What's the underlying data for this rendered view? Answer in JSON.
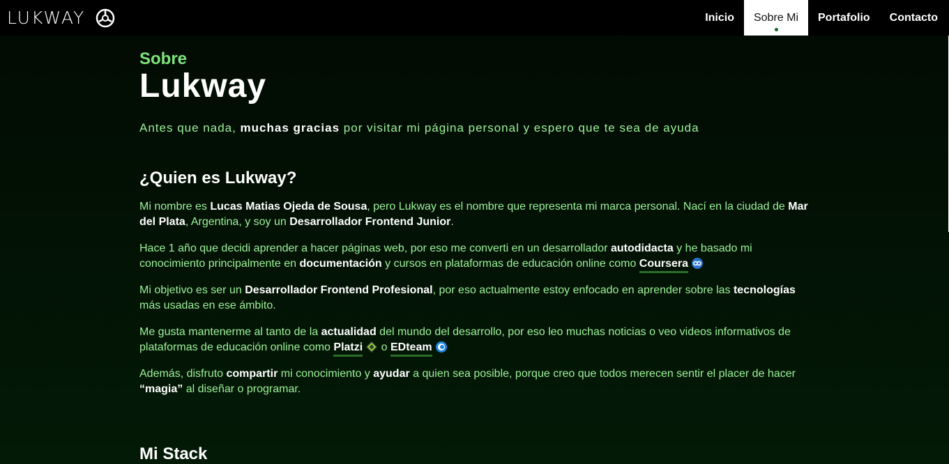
{
  "brand": {
    "name": "LUKWAY"
  },
  "nav": {
    "items": [
      {
        "label": "Inicio",
        "active": false
      },
      {
        "label": "Sobre Mi",
        "active": true
      },
      {
        "label": "Portafolio",
        "active": false
      },
      {
        "label": "Contacto",
        "active": false
      }
    ]
  },
  "hero": {
    "eyebrow": "Sobre",
    "title": "Lukway",
    "intro_pre": "Antes que nada, ",
    "intro_bold": "muchas gracias",
    "intro_post": " por visitar mi página personal y espero que te sea de ayuda"
  },
  "about": {
    "heading": "¿Quien es Lukway?",
    "p1": {
      "a": "Mi nombre es ",
      "b": "Lucas Matias Ojeda de Sousa",
      "c": ", pero Lukway es el nombre que representa mi marca personal. Nací en la ciudad de ",
      "d": "Mar del Plata",
      "e": ", Argentina, y soy un ",
      "f": "Desarrollador Frontend Junior",
      "g": "."
    },
    "p2": {
      "a": "Hace 1 año que decidi aprender a hacer páginas web, por eso me converti en un desarrollador ",
      "b": "autodidacta",
      "c": " y he basado mi conocimiento principalmente en ",
      "d": "documentación",
      "e": " y cursos en plataformas de educación online como ",
      "link": "Coursera"
    },
    "p3": {
      "a": "Mi objetivo es ser un ",
      "b": "Desarrollador Frontend Profesional",
      "c": ", por eso actualmente estoy enfocado en aprender sobre las ",
      "d": "tecnologías",
      "e": " más usadas en ese ámbito."
    },
    "p4": {
      "a": "Me gusta mantenerme al tanto de la ",
      "b": "actualidad",
      "c": " del mundo del desarrollo, por eso leo muchas noticias o veo videos informativos de plataformas de educación online como ",
      "link1": "Platzi",
      "mid": " o ",
      "link2": "EDteam"
    },
    "p5": {
      "a": "Además, disfruto ",
      "b": "compartir",
      "c": " mi conocimiento y ",
      "d": "ayudar",
      "e": " a quien sea posible, porque creo que todos merecen sentir el placer de hacer ",
      "f": "“magia”",
      "g": " al diseñar o programar."
    }
  },
  "stack": {
    "heading": "Mi Stack"
  },
  "colors": {
    "accent": "#7ee67c",
    "text": "#9ef29a",
    "nav_bg": "#000000",
    "link_underline": "#2a6e2a"
  }
}
